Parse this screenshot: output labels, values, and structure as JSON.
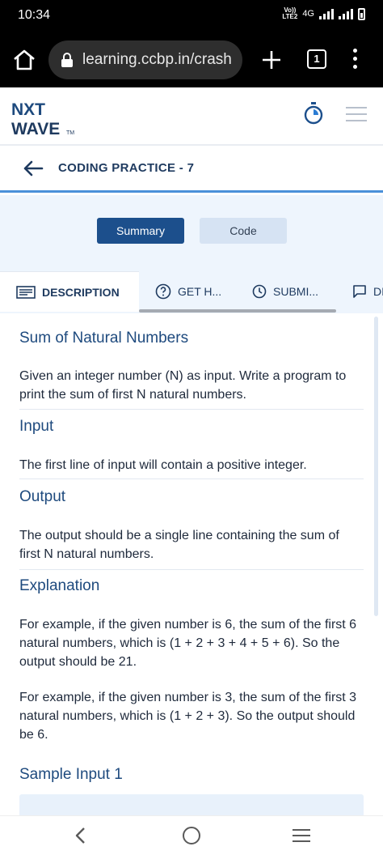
{
  "status_bar": {
    "time": "10:34",
    "volte_top": "Vo))",
    "volte_bottom": "LTE2",
    "network": "4G"
  },
  "browser": {
    "url": "learning.ccbp.in/crash",
    "tab_count": "1"
  },
  "header": {
    "logo_line1": "NXT",
    "logo_line2": "WAVE",
    "logo_tm": "TM"
  },
  "practice": {
    "title": "CODING PRACTICE - 7"
  },
  "toggle": {
    "summary_label": "Summary",
    "code_label": "Code"
  },
  "tabs": {
    "description": "DESCRIPTION",
    "hints": "GET H...",
    "submissions": "SUBMI...",
    "discuss": "DI"
  },
  "problem": {
    "title": "Sum of Natural Numbers",
    "statement": "Given an integer number (N) as input. Write a program to print the sum of first N natural numbers.",
    "input_heading": "Input",
    "input_text": "The first line of input will contain a positive integer.",
    "output_heading": "Output",
    "output_text": "The output should be a single line containing the sum of first N natural numbers.",
    "explanation_heading": "Explanation",
    "explanation_1": "For example, if the given number is 6, the sum of the first 6 natural numbers, which is (1 + 2 + 3 + 4 + 5 + 6). So the output should be 21.",
    "explanation_2": "For example, if the given number is 3, the sum of the first 3 natural numbers, which is (1 + 2 + 3). So the output should be 6.",
    "sample_input_heading": "Sample Input 1"
  },
  "colors": {
    "accent": "#1c4f8c",
    "heading": "#1e4a7e",
    "tab_bg": "#eef5fd",
    "progress_line": "#4a90d9"
  }
}
